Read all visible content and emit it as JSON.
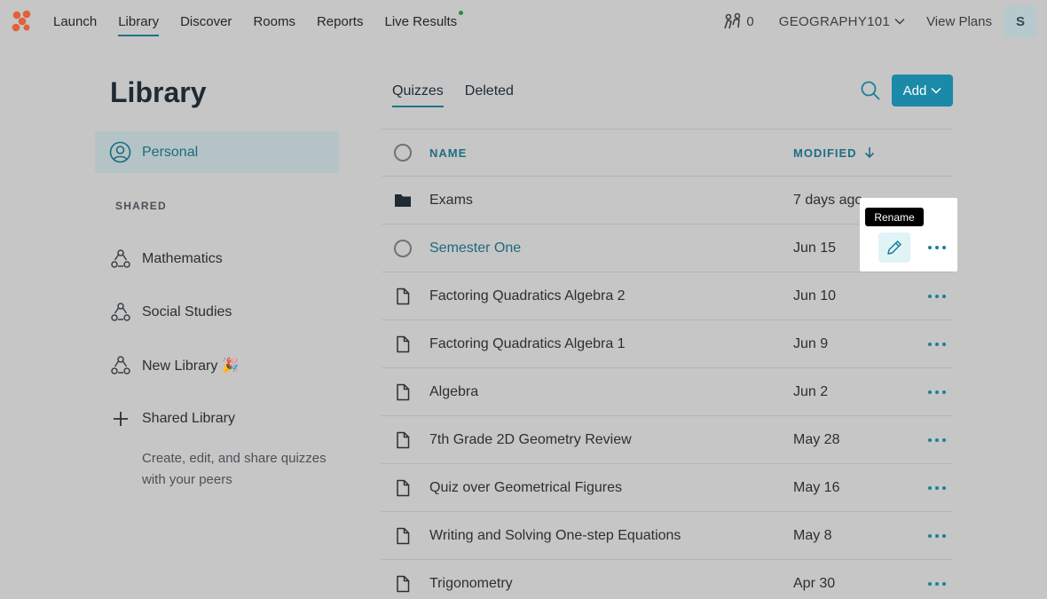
{
  "topnav": {
    "items": [
      {
        "label": "Launch",
        "active": false
      },
      {
        "label": "Library",
        "active": true
      },
      {
        "label": "Discover",
        "active": false
      },
      {
        "label": "Rooms",
        "active": false
      },
      {
        "label": "Reports",
        "active": false
      },
      {
        "label": "Live Results",
        "active": false,
        "live_indicator": true
      }
    ],
    "student_count": "0",
    "class_name": "GEOGRAPHY101",
    "view_plans": "View Plans",
    "avatar_initial": "S"
  },
  "sidebar": {
    "title": "Library",
    "personal_label": "Personal",
    "shared_heading": "SHARED",
    "shared_items": [
      {
        "label": "Mathematics"
      },
      {
        "label": "Social Studies"
      },
      {
        "label": "New Library 🎉"
      }
    ],
    "add_shared_label": "Shared Library",
    "help_text": "Create, edit, and share quizzes with your peers"
  },
  "main": {
    "tabs": [
      {
        "label": "Quizzes",
        "active": true
      },
      {
        "label": "Deleted",
        "active": false
      }
    ],
    "add_button": "Add",
    "columns": {
      "name": "NAME",
      "modified": "MODIFIED"
    },
    "rows": [
      {
        "type": "folder",
        "name": "Exams",
        "modified": "7 days ago"
      },
      {
        "type": "selectable",
        "name": "Semester One",
        "modified": "Jun 15",
        "hovered": true
      },
      {
        "type": "quiz",
        "name": "Factoring Quadratics Algebra 2",
        "modified": "Jun 10"
      },
      {
        "type": "quiz",
        "name": "Factoring Quadratics Algebra 1",
        "modified": "Jun 9"
      },
      {
        "type": "quiz",
        "name": "Algebra",
        "modified": "Jun 2"
      },
      {
        "type": "quiz",
        "name": "7th Grade 2D Geometry Review",
        "modified": "May 28"
      },
      {
        "type": "quiz",
        "name": "Quiz over Geometrical Figures",
        "modified": "May 16"
      },
      {
        "type": "quiz",
        "name": "Writing and Solving One-step Equations",
        "modified": "May 8"
      },
      {
        "type": "quiz",
        "name": "Trigonometry",
        "modified": "Apr 30"
      }
    ],
    "tooltip": "Rename"
  },
  "colors": {
    "accent": "#1a8aa8",
    "link": "#1c6a7d",
    "background": "#c6c6c6",
    "logo": "#e0613a"
  }
}
